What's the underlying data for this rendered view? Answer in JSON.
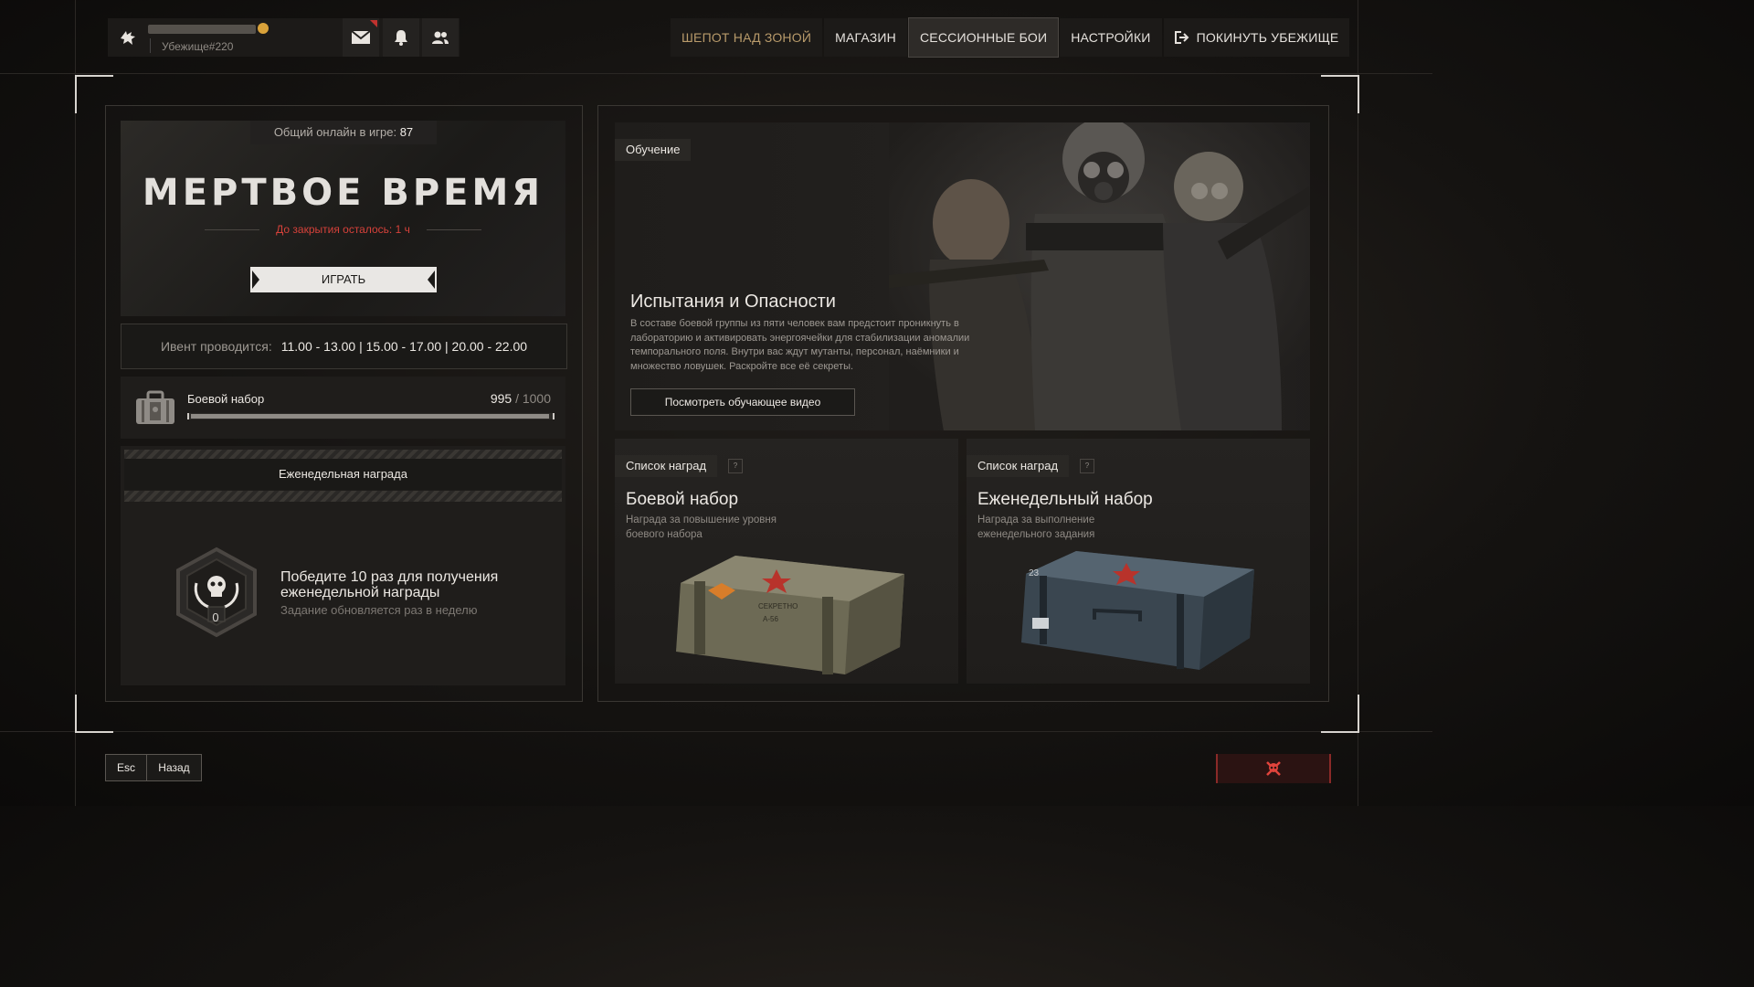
{
  "profile": {
    "shelter": "Убежище#220",
    "icons": [
      "wolf-icon",
      "mail-icon",
      "bell-icon",
      "friends-icon"
    ]
  },
  "nav": {
    "items": [
      {
        "label": "ШЕПОТ НАД ЗОНОЙ"
      },
      {
        "label": "МАГАЗИН"
      },
      {
        "label": "СЕССИОННЫЕ БОИ"
      },
      {
        "label": "НАСТРОЙКИ"
      },
      {
        "label": "ПОКИНУТЬ УБЕЖИЩЕ"
      }
    ],
    "active": "СЕССИОННЫЕ БОИ"
  },
  "event": {
    "online_label": "Общий онлайн в игре:",
    "online_count": "87",
    "title": "МЕРТВОЕ ВРЕМЯ",
    "closing": "До закрытия осталось: 1 ч",
    "play_label": "ИГРАТЬ",
    "schedule_label": "Ивент проводится:",
    "schedule_value": "11.00 - 13.00 | 15.00 - 17.00 | 20.00 - 22.00"
  },
  "kit": {
    "label": "Боевой набор",
    "current": "995",
    "max": "1000",
    "sep": "/",
    "progress": 0.995
  },
  "weekly": {
    "title": "Еженедельная награда",
    "main": "Победите 10 раз для получения еженедельной награды",
    "sub": "Задание обновляется раз в неделю",
    "count": "0"
  },
  "tutorial": {
    "tag": "Обучение",
    "title": "Испытания и Опасности",
    "desc": "В составе боевой группы из пяти человек вам предстоит проникнуть в лабораторию и активировать энергоячейки для стабилизации аномалии темпорального поля. Внутри вас ждут мутанты, персонал, наёмники и множество ловушек. Раскройте все её секреты.",
    "button": "Посмотреть обучающее видео"
  },
  "rewards": [
    {
      "tag": "Список наград",
      "q": "?",
      "title": "Боевой набор",
      "desc": "Награда за повышение уровня боевого набора",
      "crate_text": "СЕКРЕТНО",
      "crate_code": "А-56"
    },
    {
      "tag": "Список наград",
      "q": "?",
      "title": "Еженедельный набор",
      "desc": "Награда за выполнение еженедельного задания",
      "crate_text": "23"
    }
  ],
  "bottom": {
    "esc": "Esc",
    "back": "Назад"
  },
  "colors": {
    "accent_red": "#d6413a",
    "gold": "#b89a6a",
    "panel": "#1f1d1b"
  }
}
